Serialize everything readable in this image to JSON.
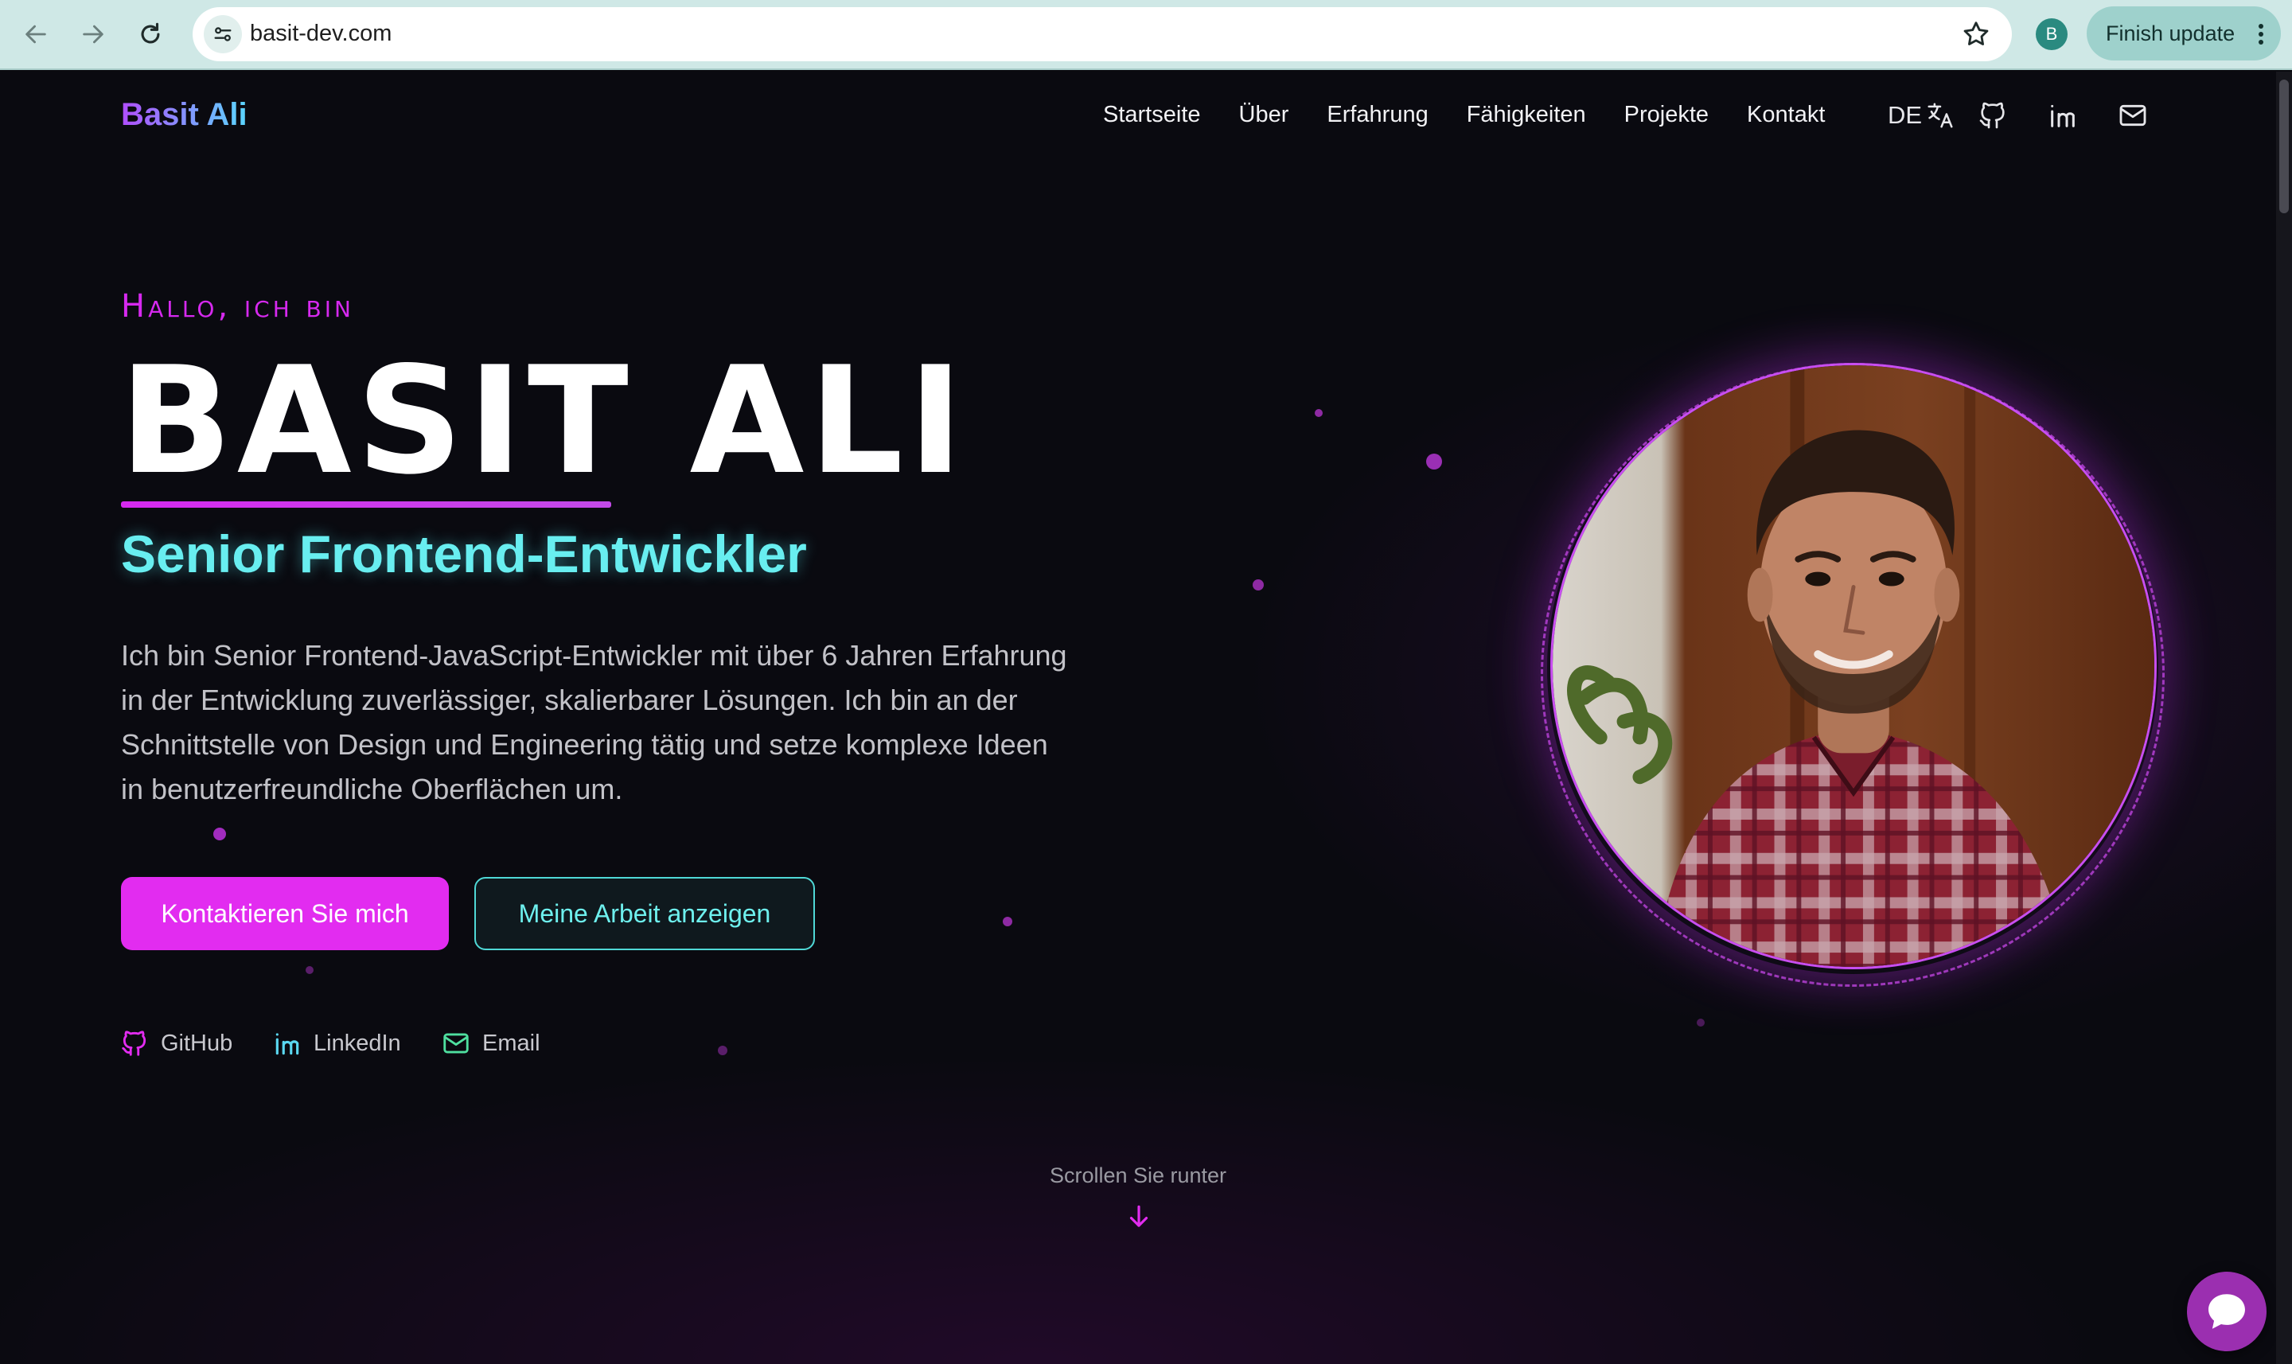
{
  "browser": {
    "url": "basit-dev.com",
    "profile_initial": "B",
    "update_button": "Finish update"
  },
  "site": {
    "brand": "Basit Ali",
    "nav": [
      "Startseite",
      "Über",
      "Erfahrung",
      "Fähigkeiten",
      "Projekte",
      "Kontakt"
    ],
    "language": "DE"
  },
  "hero": {
    "greeting": "Hallo, ich bin",
    "name": "BASIT ALI",
    "role": "Senior Frontend-Entwickler",
    "description": "Ich bin Senior Frontend-JavaScript-Entwickler mit über 6 Jahren Erfahrung in der Entwicklung zuverlässiger, skalierbarer Lösungen. Ich bin an der Schnittstelle von Design und Engineering tätig und setze komplexe Ideen in benutzerfreundliche Oberflächen um.",
    "primary_button": "Kontaktieren Sie mich",
    "secondary_button": "Meine Arbeit anzeigen",
    "links": {
      "github": "GitHub",
      "linkedin": "LinkedIn",
      "email": "Email"
    },
    "scroll_hint": "Scrollen Sie runter"
  },
  "colors": {
    "accent_magenta": "#e22cf0",
    "accent_cyan": "#68eef0",
    "background": "#0a0a10"
  },
  "icons": [
    "back-icon",
    "forward-icon",
    "reload-icon",
    "site-info-icon",
    "bookmark-star-icon",
    "translate-icon",
    "github-icon",
    "linkedin-icon",
    "mail-icon",
    "arrow-down-icon",
    "chat-icon"
  ]
}
